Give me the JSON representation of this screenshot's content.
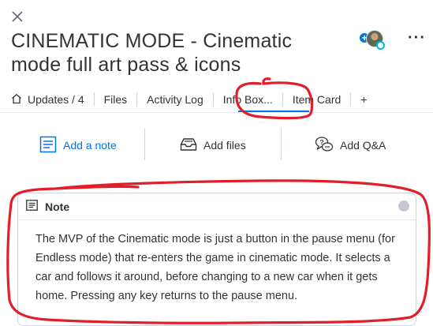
{
  "header": {
    "title": "CINEMATIC MODE - Cinematic mode full art pass & icons"
  },
  "tabs": [
    {
      "label": "Updates / 4",
      "icon": "home-icon"
    },
    {
      "label": "Files"
    },
    {
      "label": "Activity Log"
    },
    {
      "label": "Info Box...",
      "active": true
    },
    {
      "label": "Item Card"
    },
    {
      "label": "+"
    }
  ],
  "actions": {
    "add_note": "Add a note",
    "add_files": "Add files",
    "add_qa": "Add Q&A"
  },
  "note": {
    "header": "Note",
    "body": "The MVP of the Cinematic mode is just a button in the pause menu (for Endless mode) that re-enters the game in cinematic mode. It selects a car and follows it around, before changing to a new car when it gets home. Pressing any key returns to the pause menu."
  },
  "colors": {
    "accent": "#0073ea",
    "annotation": "#e01f2a",
    "text": "#323338",
    "border": "#d0d4e4"
  },
  "icons": {
    "close": "close-icon",
    "more": "more-icon",
    "add_note": "note-icon",
    "add_files": "inbox-icon",
    "add_qa": "qa-icon"
  }
}
